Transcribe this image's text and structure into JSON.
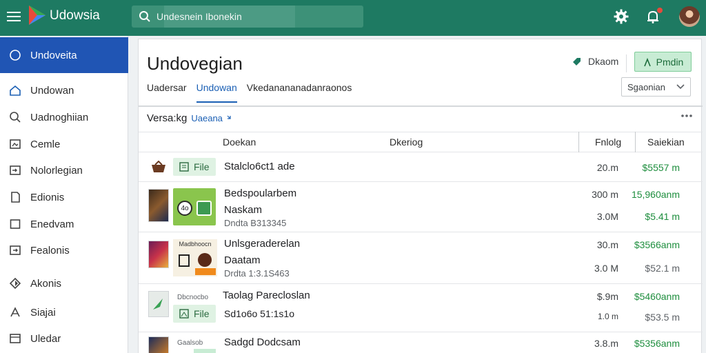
{
  "app": {
    "title": "Udowsia",
    "colors": {
      "topbar": "#1e7a62",
      "sidebar_active": "#2055b4",
      "accent_green": "#1e8e3e",
      "link_blue": "#1a5fb4"
    }
  },
  "search": {
    "value": "Undesnein Ibonekin"
  },
  "topbar_icons": [
    "gear-icon",
    "bell-icon",
    "avatar"
  ],
  "sidebar": {
    "active": {
      "label": "Undoveita",
      "icon": "circle-icon"
    },
    "items": [
      {
        "label": "Undowan",
        "icon": "home-icon"
      },
      {
        "label": "Uadnoghiian",
        "icon": "search-icon"
      },
      {
        "label": "Cemle",
        "icon": "image-icon"
      },
      {
        "label": "Nolorlegian",
        "icon": "import-icon"
      },
      {
        "label": "Edionis",
        "icon": "doc-icon"
      },
      {
        "label": "Enedvam",
        "icon": "square-icon"
      },
      {
        "label": "Fealonis",
        "icon": "export-icon"
      },
      {
        "label": "Akonis",
        "icon": "brightness-icon"
      },
      {
        "label": "Siajai",
        "icon": "share-icon"
      },
      {
        "label": "Uledar",
        "icon": "card-icon"
      }
    ]
  },
  "main": {
    "title": "Undovegian",
    "header_link": "Dkaom",
    "primary_button": "Pmdin",
    "tabs": [
      {
        "label": "Uadersar",
        "active": false
      },
      {
        "label": "Undowan",
        "active": true
      },
      {
        "label": "Vkedanananadanraonos",
        "active": false
      }
    ],
    "select": {
      "value": "Sgaonian"
    },
    "section": {
      "title": "Versa:kg",
      "subtitle": "Uaeana"
    },
    "columns": {
      "name": "Doekan",
      "type": "Dkeriog",
      "size": "Fnlolg",
      "price": "Saiekian"
    },
    "rows": [
      {
        "chip": "File",
        "title": "Stalclo6ct1 ade",
        "line2": "",
        "sub": "",
        "size": "20.m",
        "size2": "",
        "price": "$5557 m",
        "price2": ""
      },
      {
        "chip": "",
        "tile_label": "4o",
        "title": "Bedspoularbem",
        "line2": "Naskam",
        "sub": "Dndta B313345",
        "size": "300 m",
        "size2": "3.0M",
        "price": "15,960anm",
        "price2": "$5.41 m"
      },
      {
        "chip": "",
        "thumb_label": "Madbhoocn",
        "title": "Unlsgeraderelan",
        "line2": "Daatam",
        "sub": "Drdta 1:3.1S463",
        "size": "30.m",
        "size2": "3.0 M",
        "price": "$3566anm",
        "price2": "$52.1 m"
      },
      {
        "chip": "File",
        "thumb_label": "Dbcnocbo",
        "title": "Taolag Parecloslan",
        "line2": "",
        "sub": "Sd1o6o 51:1s1o",
        "size": "$.9m",
        "size2": "1.0 m",
        "price": "$5460anm",
        "price2": "$53.5 m"
      },
      {
        "chip": "",
        "thumb_label": "Gaalsob",
        "title": "Sadgd Dodcsam",
        "line2": "",
        "sub": "",
        "size": "3.8.m",
        "size2": "",
        "price": "$5356anm",
        "price2": ""
      }
    ]
  }
}
